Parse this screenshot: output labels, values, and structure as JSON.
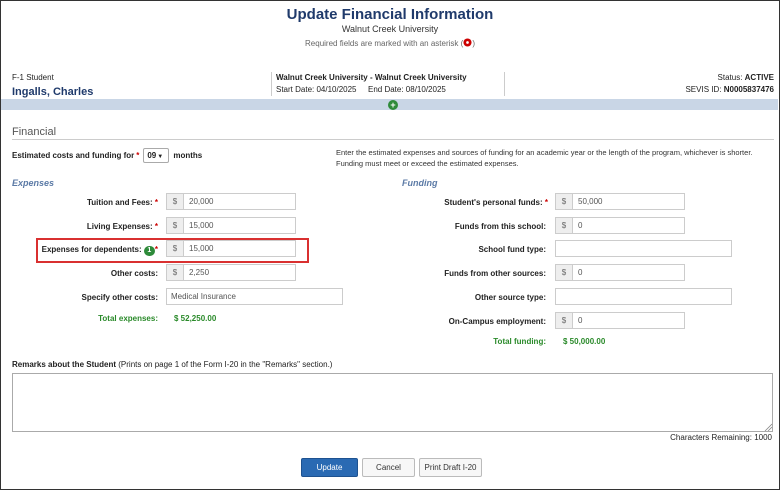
{
  "header": {
    "title": "Update Financial Information",
    "school": "Walnut Creek University",
    "required_note": "Required fields are marked with an asterisk ("
  },
  "student": {
    "type": "F-1 Student",
    "name": "Ingalls, Charles",
    "program": "Walnut Creek University - Walnut Creek University",
    "start_date": "Start Date: 04/10/2025",
    "end_date": "End Date: 08/10/2025",
    "status_label": "Status:",
    "status_value": "ACTIVE",
    "sevis_label": "SEVIS ID:",
    "sevis_value": "N0005837476"
  },
  "financial": {
    "section_title": "Financial",
    "period_label": "Estimated costs and funding for",
    "months_value": "09",
    "months_label": "months",
    "description_line1": "Enter the estimated expenses and sources of funding for an academic year or the length of the program, whichever is shorter.",
    "description_line2": "Funding must meet or exceed the estimated expenses.",
    "currency_symbol": "$"
  },
  "expenses": {
    "heading": "Expenses",
    "tuition_label": "Tuition and Fees:",
    "tuition_value": "20,000",
    "living_label": "Living Expenses:",
    "living_value": "15,000",
    "dependents_label": "Expenses for dependents:",
    "dependents_badge": "1",
    "dependents_value": "15,000",
    "other_label": "Other costs:",
    "other_value": "2,250",
    "specify_label": "Specify other costs:",
    "specify_value": "Medical Insurance",
    "total_label": "Total expenses:",
    "total_value": "$ 52,250.00"
  },
  "funding": {
    "heading": "Funding",
    "personal_label": "Student's personal funds:",
    "personal_value": "50,000",
    "school_label": "Funds from this school:",
    "school_value": "0",
    "school_type_label": "School fund type:",
    "school_type_value": "",
    "other_label": "Funds from other sources:",
    "other_value": "0",
    "other_type_label": "Other source type:",
    "other_type_value": "",
    "campus_label": "On-Campus employment:",
    "campus_value": "0",
    "total_label": "Total funding:",
    "total_value": "$ 50,000.00"
  },
  "remarks": {
    "label": "Remarks about the Student",
    "hint": "(Prints on page 1 of the Form I-20 in the \"Remarks\" section.)",
    "value": "",
    "chars_remaining": "Characters Remaining: 1000"
  },
  "actions": {
    "update": "Update",
    "cancel": "Cancel",
    "print_draft": "Print Draft I-20"
  },
  "colors": {
    "title_blue": "#1f3a6b",
    "band": "#c9d6e6",
    "green": "#2e8b3a",
    "required_red": "#cc0000",
    "highlight_red": "#d93030",
    "primary_button": "#2a6ab3"
  }
}
